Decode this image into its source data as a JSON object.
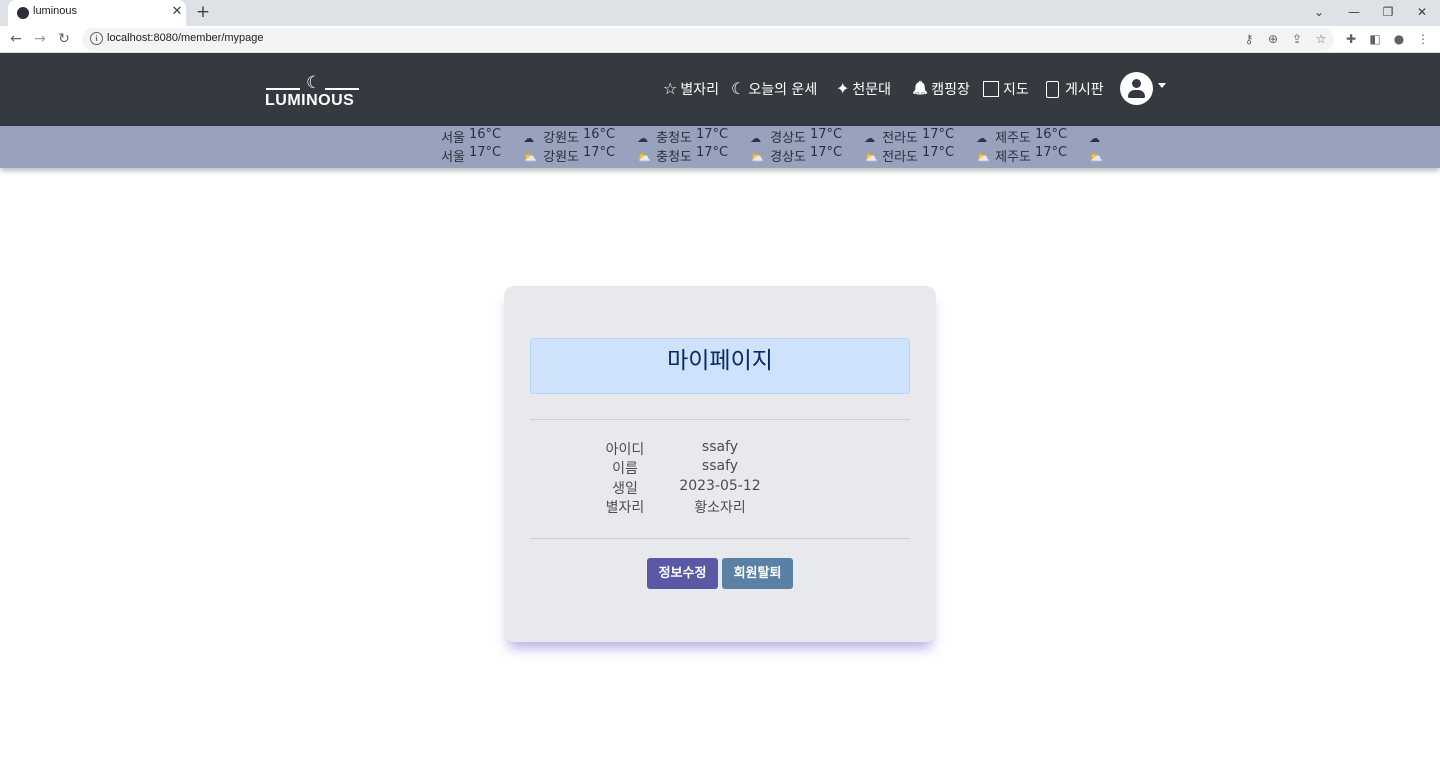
{
  "browser": {
    "tab_title": "luminous",
    "tab_close": "✕",
    "new_tab": "+",
    "url": "localhost:8080/member/mypage",
    "window_controls": [
      "⌄",
      "—",
      "❐",
      "✕"
    ]
  },
  "header": {
    "logo_text": "LUMINOUS",
    "menu": [
      {
        "icon": "star-icon",
        "glyph": "☆",
        "label": "별자리"
      },
      {
        "icon": "moon-icon",
        "glyph": "☾",
        "label": "오늘의 운세"
      },
      {
        "icon": "sparkle-icon",
        "glyph": "✦",
        "label": "천문대"
      },
      {
        "icon": "bell-icon",
        "glyph": "🔔",
        "label": "캠핑장"
      },
      {
        "icon": "map-icon",
        "glyph": "▯",
        "label": "지도"
      },
      {
        "icon": "clipboard-icon",
        "glyph": "📋",
        "label": "게시판"
      }
    ]
  },
  "weather": {
    "regions": [
      {
        "name": "서울",
        "temp_high": "16°C",
        "temp_low": "17°C"
      },
      {
        "name": "강원도",
        "temp_high": "16°C",
        "temp_low": "17°C"
      },
      {
        "name": "충청도",
        "temp_high": "17°C",
        "temp_low": "17°C"
      },
      {
        "name": "경상도",
        "temp_high": "17°C",
        "temp_low": "17°C"
      },
      {
        "name": "전라도",
        "temp_high": "17°C",
        "temp_low": "17°C"
      },
      {
        "name": "제주도",
        "temp_high": "16°C",
        "temp_low": "17°C"
      }
    ]
  },
  "mypage": {
    "title": "마이페이지",
    "fields": [
      {
        "label": "아이디",
        "value": "ssafy"
      },
      {
        "label": "이름",
        "value": "ssafy"
      },
      {
        "label": "생일",
        "value": "2023-05-12"
      },
      {
        "label": "별자리",
        "value": "황소자리"
      }
    ],
    "edit_button": "정보수정",
    "withdraw_button": "회원탈퇴"
  }
}
